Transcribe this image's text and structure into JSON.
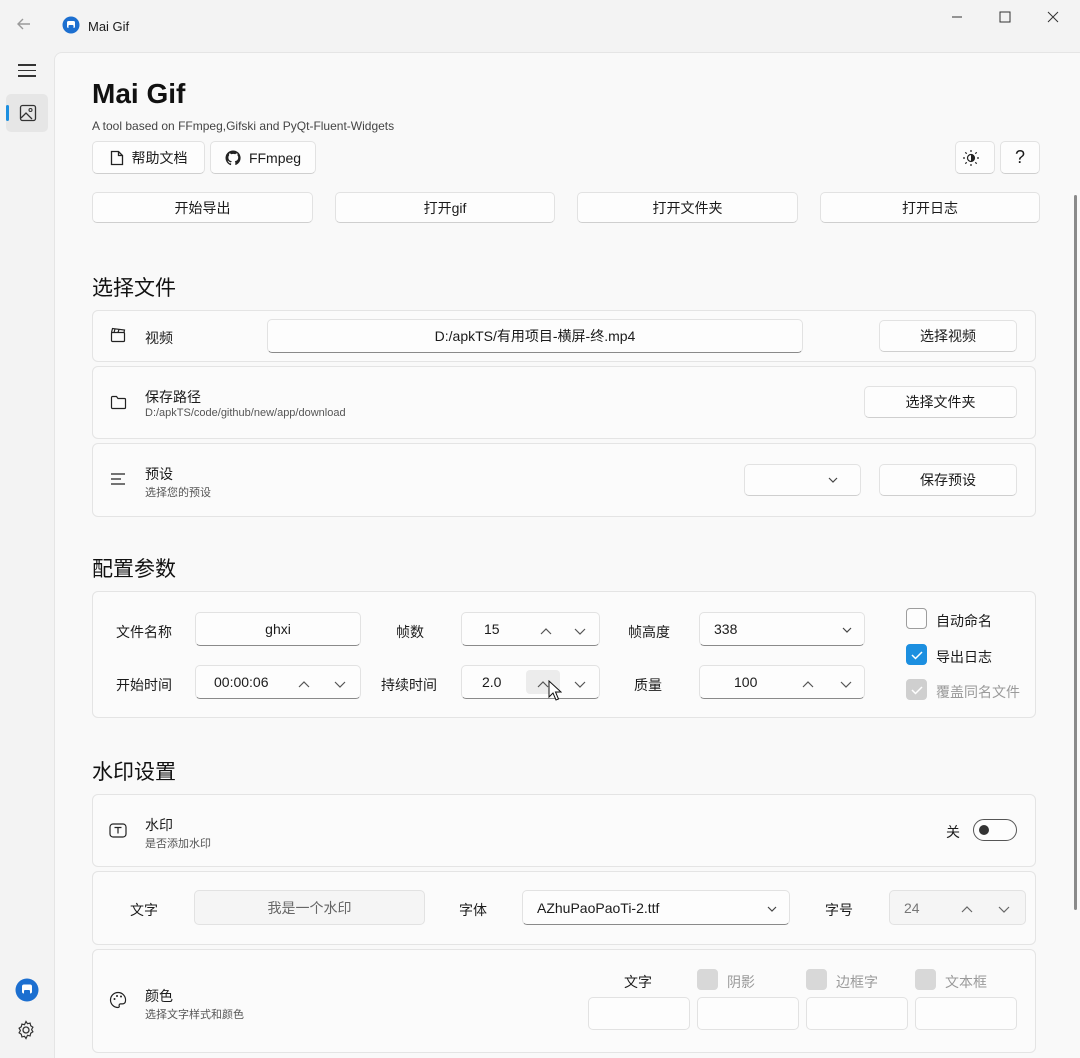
{
  "window": {
    "title": "Mai Gif",
    "controls": {
      "minimize": "—",
      "maximize": "☐",
      "close": "✕"
    }
  },
  "header": {
    "title": "Mai Gif",
    "subtitle": "A tool based on FFmpeg,Gifski and PyQt-Fluent-Widgets",
    "help_doc": "帮助文档",
    "ffmpeg": "FFmpeg",
    "help_icon_text": "?"
  },
  "actions": {
    "start_export": "开始导出",
    "open_gif": "打开gif",
    "open_folder": "打开文件夹",
    "open_log": "打开日志"
  },
  "select_file": {
    "title": "选择文件",
    "video_label": "视频",
    "video_path": "D:/apkTS/有用项目-横屏-终.mp4",
    "select_video": "选择视频",
    "save_path_label": "保存路径",
    "save_path_value": "D:/apkTS/code/github/new/app/download",
    "select_folder": "选择文件夹",
    "preset_label": "预设",
    "preset_sub": "选择您的预设",
    "preset_value": "",
    "save_preset": "保存预设"
  },
  "config": {
    "title": "配置参数",
    "filename_label": "文件名称",
    "filename_value": "ghxi",
    "fps_label": "帧数",
    "fps_value": "15",
    "frame_height_label": "帧高度",
    "frame_height_value": "338",
    "start_time_label": "开始时间",
    "start_time_value": "00:00:06",
    "duration_label": "持续时间",
    "duration_value": "2.0",
    "quality_label": "质量",
    "quality_value": "100",
    "auto_name": {
      "label": "自动命名",
      "checked": false
    },
    "export_log": {
      "label": "导出日志",
      "checked": true
    },
    "overwrite": {
      "label": "覆盖同名文件",
      "checked": true,
      "disabled": true
    }
  },
  "watermark": {
    "title": "水印设置",
    "label": "水印",
    "sub": "是否添加水印",
    "toggle_text": "关",
    "toggle_on": false,
    "text_label": "文字",
    "text_value": "我是一个水印",
    "font_label": "字体",
    "font_value": "AZhuPaoPaoTi-2.ttf",
    "size_label": "字号",
    "size_value": "24",
    "color_label": "颜色",
    "color_sub": "选择文字样式和颜色",
    "color_text_label": "文字",
    "shadow_label": "阴影",
    "border_label": "边框字",
    "textbox_label": "文本框"
  },
  "colors": {
    "accent": "#1c8fe0",
    "background": "#f3f3f3",
    "panel": "#f9f9f9"
  }
}
